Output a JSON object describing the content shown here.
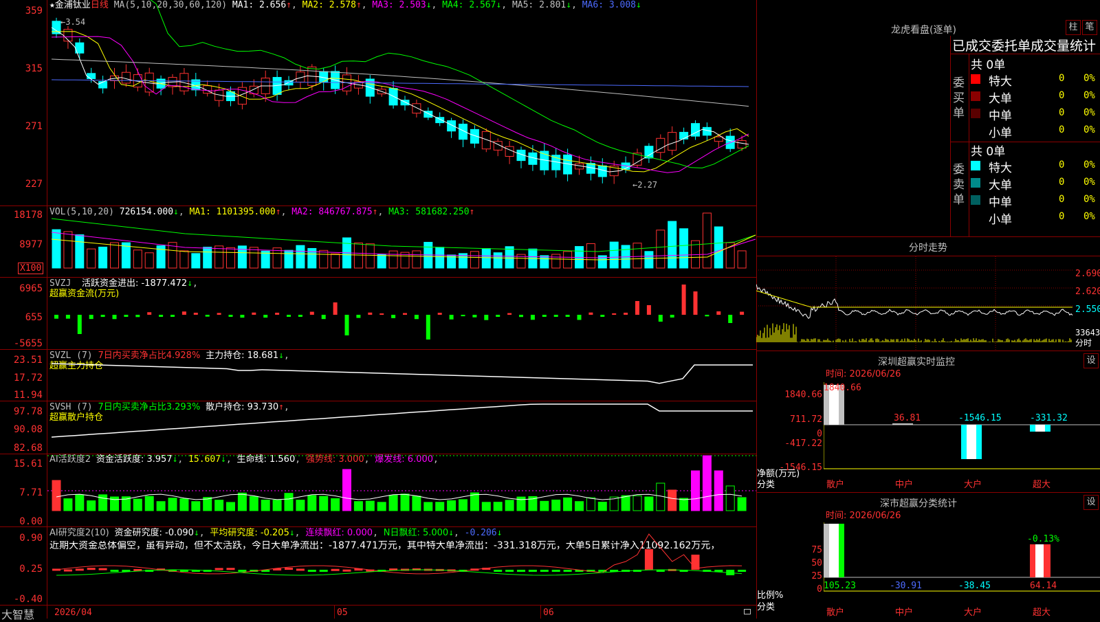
{
  "stock": {
    "name": "金浦钛业",
    "period": "日线"
  },
  "main": {
    "ma_prefix": "MA(5,10,20,30,60,120)",
    "ma1": "MA1: 2.656",
    "ma2": "MA2: 2.578",
    "ma3": "MA3: 2.503",
    "ma4": "MA4: 2.567",
    "ma5": "MA5: 2.801",
    "ma6": "MA6: 3.008",
    "yaxis": [
      "359",
      "315",
      "271",
      "227"
    ],
    "high_label": "3.54",
    "low_label": "2.27",
    "colors": {
      "ma1": "#ffffff",
      "ma2": "#ffff00",
      "ma3": "#ff00ff",
      "ma4": "#00ff00",
      "ma5": "#c0c0c0",
      "ma6": "#4d6bff",
      "up": "#ff3232",
      "down": "#00ffff"
    }
  },
  "vol": {
    "prefix": "VOL(5,10,20)",
    "value": "726154.000",
    "ma1": "MA1: 1101395.000",
    "ma2": "MA2: 846767.875",
    "ma3": "MA3: 581682.250",
    "yaxis": [
      "18178",
      "8977"
    ],
    "unit": "X100"
  },
  "svzj": {
    "prefix": "SVZJ",
    "label": "活跃资金进出: -1877.472",
    "sub": "超赢资金流(万元)",
    "yaxis": [
      "6965",
      "655",
      "-5655"
    ]
  },
  "svzl": {
    "prefix": "SVZL (7)",
    "ratio": "7日内买卖净占比4.928%",
    "hold": "主力持仓: 18.681",
    "sub": "超赢主力持仓",
    "yaxis": [
      "23.51",
      "17.72",
      "11.94"
    ]
  },
  "svsh": {
    "prefix": "SVSH (7)",
    "ratio": "7日内买卖净占比3.293%",
    "hold": "散户持仓: 93.730",
    "sub": "超赢散户持仓",
    "yaxis": [
      "97.78",
      "90.08",
      "82.68"
    ]
  },
  "ai1": {
    "prefix": "AI活跃度2",
    "active": "资金活跃度: 3.957",
    "v2": "15.607",
    "life": "生命线: 1.560",
    "strong": "强势线: 3.000",
    "burst": "爆发线: 6.000",
    "yaxis": [
      "15.61",
      "7.71",
      "0.00"
    ]
  },
  "ai2": {
    "prefix": "AI研究度2(10)",
    "research": "资金研究度: -0.090",
    "avg": "平均研究度: -0.205",
    "cont": "连续飘红: 0.000",
    "nday": "N日飘红: 5.000",
    "last": "-0.206",
    "comment": "近期大资金总体偏空，虽有异动，但不太活跃，今日大单净流出：-1877.471万元，其中特大单净流出：-331.318万元，大单5日累计净入11092.162万元，",
    "yaxis": [
      "0.90",
      "0.25",
      "-0.40"
    ]
  },
  "xaxis": {
    "d1": "2026/04",
    "d2": "05",
    "d3": "06"
  },
  "brand": "大智慧",
  "right": {
    "lhkp_title": "龙虎看盘(逐单)",
    "btn_zhu": "柱",
    "btn_bi": "笔",
    "order_header": "已成交委托单成交量统计",
    "buy_side": "委买单",
    "sell_side": "委卖单",
    "buy_total": "共 0单",
    "sell_total": "共 0单",
    "rows": [
      {
        "label": "特大",
        "count": "0",
        "pct": "0%"
      },
      {
        "label": "大单",
        "count": "0",
        "pct": "0%"
      },
      {
        "label": "中单",
        "count": "0",
        "pct": "0%"
      },
      {
        "label": "小单",
        "count": "0",
        "pct": "0%"
      }
    ],
    "fs_title": "分时走势",
    "fs_yaxis": [
      "2.690",
      "2.620",
      "2.550",
      "33643"
    ],
    "fs_unit": "分时",
    "sz_title": "深圳超赢实时监控",
    "sz_time": "时间: 2026/06/26",
    "sz_btn": "设",
    "sz_yaxis": [
      "1840.66",
      "711.72",
      "0",
      "-417.22",
      "-1546.15"
    ],
    "sz_values": {
      "retail": "1840.66",
      "mid": "36.81",
      "large": "-1546.15",
      "super": "-331.32"
    },
    "sz_ylabel": "净额(万元)",
    "sz_xcat": "分类",
    "cats": [
      "散户",
      "中户",
      "大户",
      "超大"
    ],
    "fl_title": "深市超赢分类统计",
    "fl_time": "时间: 2026/06/26",
    "fl_btn": "设",
    "fl_yaxis": [
      "75",
      "50",
      "25",
      "0"
    ],
    "fl_values": {
      "retail": "105.23",
      "mid": "-30.91",
      "large": "-38.45",
      "super": "64.14"
    },
    "fl_top": "-0.13%",
    "fl_ylabel": "比例%",
    "fl_xcat": "分类"
  }
}
